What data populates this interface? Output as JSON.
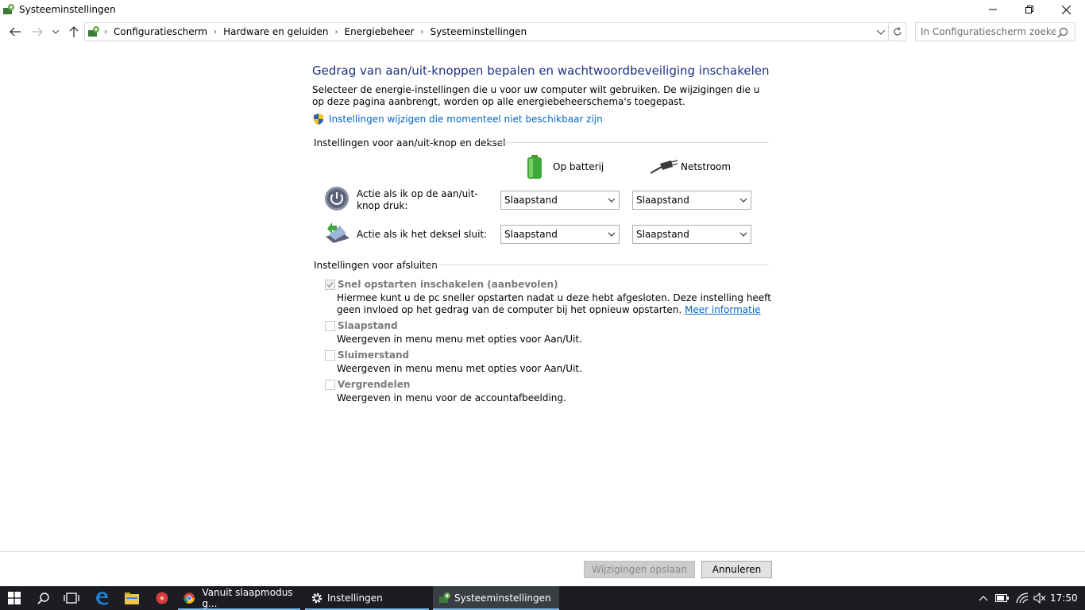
{
  "window": {
    "title": "Systeeminstellingen"
  },
  "address": {
    "breadcrumbs": [
      "Configuratiescherm",
      "Hardware en geluiden",
      "Energiebeheer",
      "Systeeminstellingen"
    ],
    "search_placeholder": "In Configuratiescherm zoeken"
  },
  "main": {
    "heading": "Gedrag van aan/uit-knoppen bepalen en wachtwoordbeveiliging inschakelen",
    "description": "Selecteer de energie-instellingen die u voor uw computer wilt gebruiken. De wijzigingen die u op deze pagina aanbrengt, worden op alle energiebeheerschema's toegepast.",
    "admin_link": "Instellingen wijzigen die momenteel niet beschikbaar zijn",
    "power_group": {
      "title": "Instellingen voor aan/uit-knop en deksel",
      "battery_label": "Op batterij",
      "ac_label": "Netstroom",
      "rows": [
        {
          "label": "Actie als ik op de aan/uit-knop druk:",
          "battery": "Slaapstand",
          "ac": "Slaapstand"
        },
        {
          "label": "Actie als ik het deksel sluit:",
          "battery": "Slaapstand",
          "ac": "Slaapstand"
        }
      ]
    },
    "shutdown_group": {
      "title": "Instellingen voor afsluiten",
      "fast_startup": {
        "label": "Snel opstarten inschakelen (aanbevolen)",
        "checked": true,
        "desc": "Hiermee kunt u de pc sneller opstarten nadat u deze hebt afgesloten. Deze instelling heeft geen invloed op het gedrag van de computer bij het opnieuw opstarten.",
        "link": "Meer informatie"
      },
      "sleep": {
        "label": "Slaapstand",
        "checked": false,
        "desc": "Weergeven in menu menu met opties voor Aan/Uit."
      },
      "hibernate": {
        "label": "Sluimerstand",
        "checked": false,
        "desc": "Weergeven in menu menu met opties voor Aan/Uit."
      },
      "lock": {
        "label": "Vergrendelen",
        "checked": false,
        "desc": "Weergeven in menu voor de accountafbeelding."
      }
    }
  },
  "footer": {
    "save_label": "Wijzigingen opslaan",
    "cancel_label": "Annuleren"
  },
  "taskbar": {
    "apps": [
      "Vanuit slaapmodus g...",
      "Instellingen",
      "Systeeminstellingen"
    ],
    "clock": "17:50"
  },
  "colors": {
    "heading": "#1e3287",
    "link": "#0066cc",
    "taskbar": "#1b1d22"
  }
}
